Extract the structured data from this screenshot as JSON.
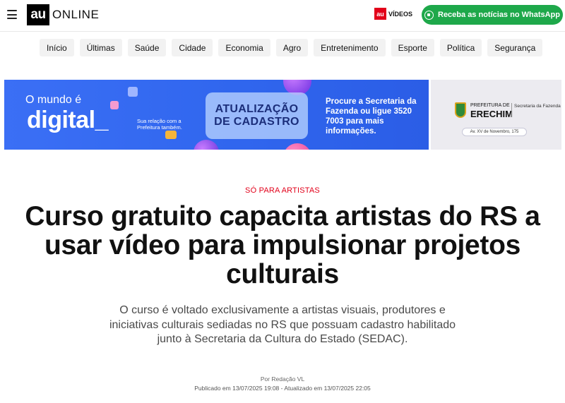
{
  "header": {
    "logo_mark": "au",
    "logo_text": "ONLINE",
    "videos_mark": "au",
    "videos_label": "VÍDEOS",
    "whatsapp_label": "Receba as notícias no WhatsApp"
  },
  "nav": {
    "items": [
      "Início",
      "Últimas",
      "Saúde",
      "Cidade",
      "Economia",
      "Agro",
      "Entretenimento",
      "Esporte",
      "Política",
      "Segurança"
    ]
  },
  "banner": {
    "line1": "O mundo é",
    "line2": "digital_",
    "tagline": "Sua relação com a Prefeitura também.",
    "card_line1": "ATUALIZAÇÃO",
    "card_line2": "DE CADASTRO",
    "cta": "Procure a Secretaria da Fazenda ou ligue 3520 7003 para mais informações.",
    "pref_line1": "PREFEITURA DE",
    "pref_line2": "ERECHIM",
    "pref_dept": "Secretaria da Fazenda",
    "address": "Av. XV de Novembro, 175"
  },
  "article": {
    "kicker": "SÓ PARA ARTISTAS",
    "headline": "Curso gratuito capacita artistas do RS a usar vídeo para impulsionar projetos culturais",
    "subheadline": "O curso é voltado exclusivamente a artistas visuais, produtores e iniciativas culturais sediadas no RS que possuam cadastro habilitado junto à Secretaria da Cultura do Estado (SEDAC).",
    "byline": "Por Redação VL",
    "dates": "Publicado em 13/07/2025 19:08 - Atualizado em 13/07/2025 22:05"
  },
  "colors": {
    "accent_red": "#e2001a",
    "whatsapp_green": "#1ea84a",
    "banner_blue": "#3066ee"
  }
}
